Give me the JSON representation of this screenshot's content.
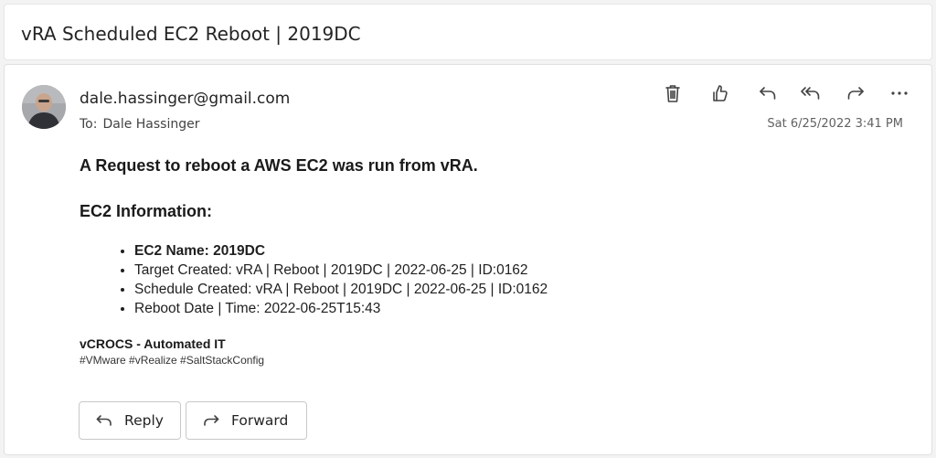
{
  "subject": "vRA Scheduled EC2 Reboot | 2019DC",
  "message": {
    "sender": "dale.hassinger@gmail.com",
    "to_label": "To:",
    "to_name": "Dale Hassinger",
    "date": "Sat 6/25/2022 3:41 PM"
  },
  "toolbar": {
    "icons": [
      "delete-icon",
      "like-icon",
      "reply-icon",
      "reply-all-icon",
      "forward-icon",
      "more-icon"
    ]
  },
  "body": {
    "lead": "A Request to reboot a AWS EC2 was run from vRA.",
    "section_title": "EC2 Information:",
    "items": [
      "EC2 Name: 2019DC",
      "Target Created: vRA | Reboot | 2019DC | 2022-06-25 | ID:0162",
      "Schedule Created: vRA | Reboot | 2019DC | 2022-06-25 | ID:0162",
      "Reboot Date | Time: 2022-06-25T15:43"
    ],
    "signature_name": "vCROCS - Automated IT",
    "signature_tags": "#VMware #vRealize #SaltStackConfig"
  },
  "buttons": {
    "reply": "Reply",
    "forward": "Forward"
  }
}
